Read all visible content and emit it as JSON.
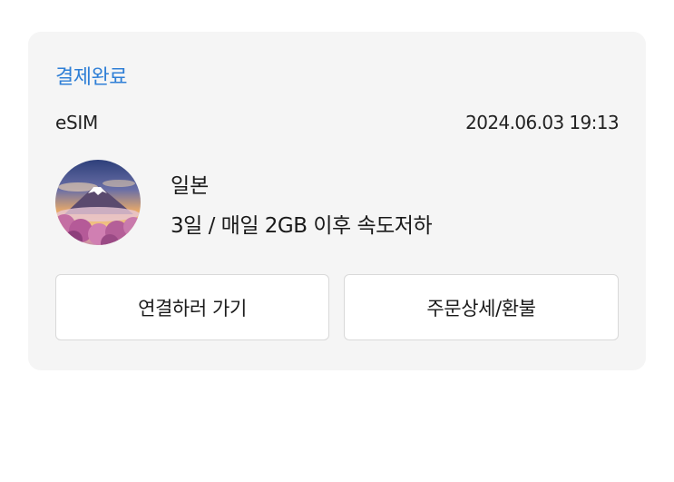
{
  "order": {
    "status": "결제완료",
    "product_type": "eSIM",
    "date": "2024.06.03 19:13",
    "thumbnail_icon": "mount-fuji-image",
    "country": "일본",
    "plan_description": "3일 / 매일 2GB 이후 속도저하"
  },
  "actions": {
    "connect_label": "연결하러 가기",
    "detail_label": "주문상세/환불"
  },
  "colors": {
    "status": "#2f7fd6",
    "card_background": "#f5f5f5"
  }
}
